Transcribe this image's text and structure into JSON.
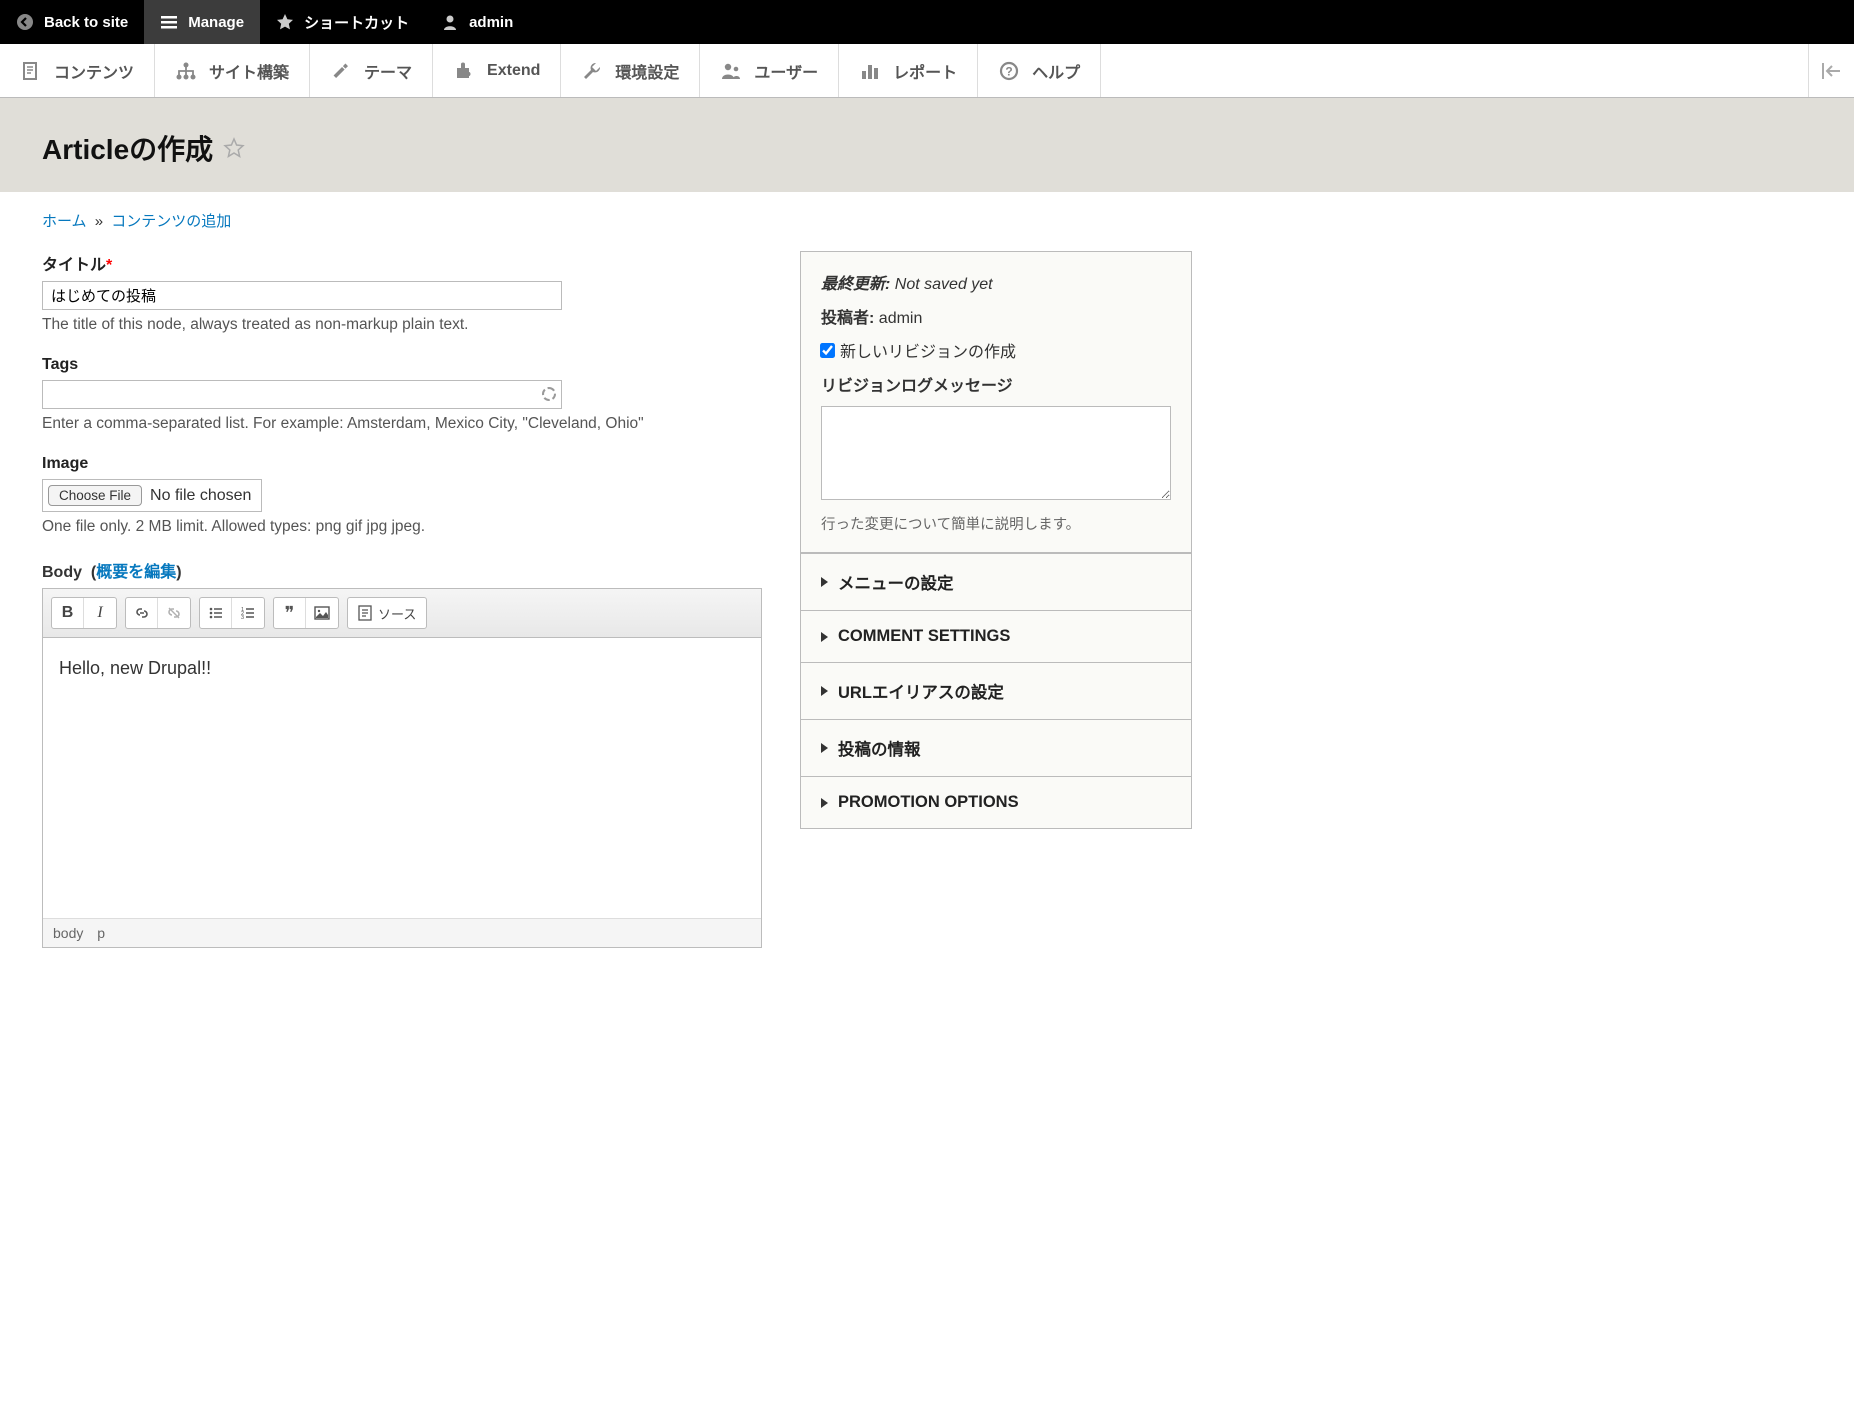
{
  "topbar": {
    "back": "Back to site",
    "manage": "Manage",
    "shortcuts": "ショートカット",
    "admin": "admin"
  },
  "navbar": {
    "items": [
      "コンテンツ",
      "サイト構築",
      "テーマ",
      "Extend",
      "環境設定",
      "ユーザー",
      "レポート",
      "ヘルプ"
    ]
  },
  "page_title": "Articleの作成",
  "breadcrumb": {
    "home": "ホーム",
    "add": "コンテンツの追加"
  },
  "fields": {
    "title_label": "タイトル",
    "title_value": "はじめての投稿",
    "title_desc": "The title of this node, always treated as non-markup plain text.",
    "tags_label": "Tags",
    "tags_desc": "Enter a comma-separated list. For example: Amsterdam, Mexico City, \"Cleveland, Ohio\"",
    "image_label": "Image",
    "choose_file": "Choose File",
    "no_file": "No file chosen",
    "image_desc": "One file only. 2 MB limit. Allowed types: png gif jpg jpeg.",
    "body_label": "Body",
    "edit_summary": "概要を編集",
    "body_content": "Hello, new Drupal!!",
    "source_btn": "ソース",
    "path_body": "body",
    "path_p": "p"
  },
  "sidebar": {
    "last_saved_label": "最終更新:",
    "last_saved_value": "Not saved yet",
    "author_label": "投稿者:",
    "author_value": "admin",
    "new_revision": "新しいリビジョンの作成",
    "revision_log_label": "リビジョンログメッセージ",
    "revision_help": "行った変更について簡単に説明します。",
    "sections": [
      "メニューの設定",
      "COMMENT SETTINGS",
      "URLエイリアスの設定",
      "投稿の情報",
      "PROMOTION OPTIONS"
    ]
  }
}
